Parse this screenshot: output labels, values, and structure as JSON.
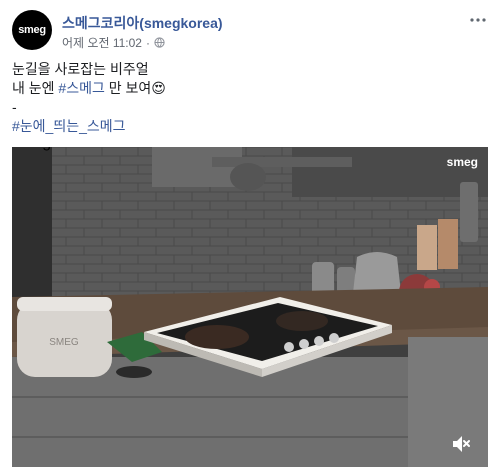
{
  "post": {
    "page_name": "스메그코리아(smegkorea)",
    "avatar_logo": "smeg",
    "timestamp": "어제 오전 11:02",
    "separator": "·",
    "privacy_icon": "globe-icon",
    "more_icon": "horizontal-dots-icon"
  },
  "caption": {
    "line1": "눈길을 사로잡는 비주얼",
    "line2_prefix": "내 눈엔 ",
    "line2_hashtag": "#스메그",
    "line2_suffix": " 만 보여",
    "line2_emoji": "😍",
    "line3": "-",
    "line4_hashtag": "#눈에_띄는_스메그"
  },
  "video": {
    "watermark": "smeg",
    "toaster_logo": "SMEG",
    "mute_icon": "speaker-muted-icon"
  },
  "colors": {
    "link": "#385898",
    "meta": "#616770",
    "text": "#1c1e21"
  }
}
